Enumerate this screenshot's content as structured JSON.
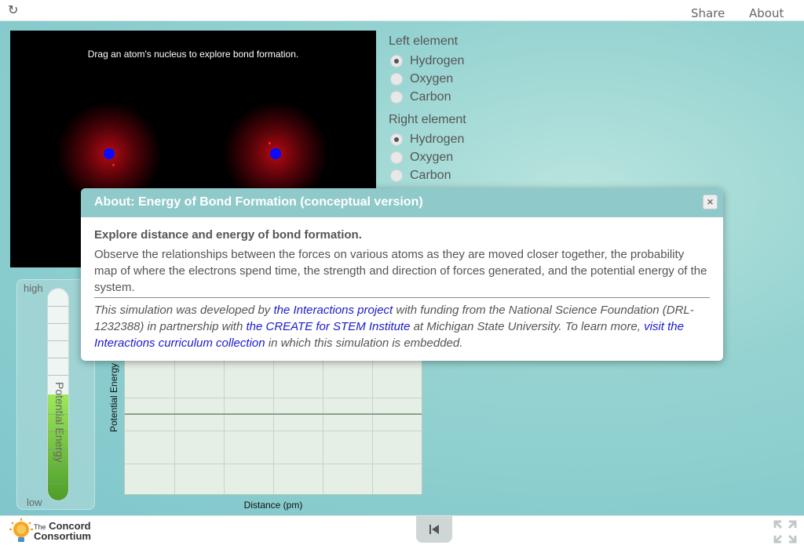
{
  "topbar": {
    "reload_icon": "reload-icon",
    "share_label": "Share",
    "about_label": "About"
  },
  "simulation": {
    "instruction": "Drag an atom's nucleus to explore bond formation."
  },
  "left_element": {
    "heading": "Left element",
    "options": [
      "Hydrogen",
      "Oxygen",
      "Carbon"
    ],
    "selected": "Hydrogen"
  },
  "right_element": {
    "heading": "Right element",
    "options": [
      "Hydrogen",
      "Oxygen",
      "Carbon"
    ],
    "selected": "Hydrogen"
  },
  "thermometer": {
    "high_label": "high",
    "low_label": "low",
    "title": "Potential Energy",
    "level_fraction": 0.5
  },
  "graph": {
    "y_label": "Potential Energy",
    "x_label": "Distance (pm)"
  },
  "about_dialog": {
    "title": "About: Energy of Bond Formation (conceptual version)",
    "close_label": "×",
    "heading": "Explore distance and energy of bond formation.",
    "description": "Observe the relationships between the forces on various atoms as they are moved closer together, the probability map of where the electrons spend time, the strength and direction of forces generated, and the potential energy of the system.",
    "credit_1": "This simulation was developed by ",
    "link_interactions": "the Interactions project",
    "credit_2": " with funding from the National Science Foundation (DRL-1232388) in partnership with ",
    "link_create": "the CREATE for STEM Institute",
    "credit_3": " at Michigan State University. To learn more, ",
    "link_collection": "visit the Interactions curriculum collection",
    "credit_4": " in which this simulation is embedded."
  },
  "footer": {
    "logo_the": "The",
    "logo_line1": "Concord",
    "logo_line2": "Consortium",
    "rewind_icon": "rewind-icon",
    "fullscreen_icon": "fullscreen-icon"
  },
  "colors": {
    "background_teal": "#95d3d1",
    "dialog_header": "#8fc9c9",
    "link": "#1a1acc",
    "nucleus": "#0a0aff",
    "electron_cloud": "#be0a14",
    "energy_fill": "#7ccb46"
  }
}
